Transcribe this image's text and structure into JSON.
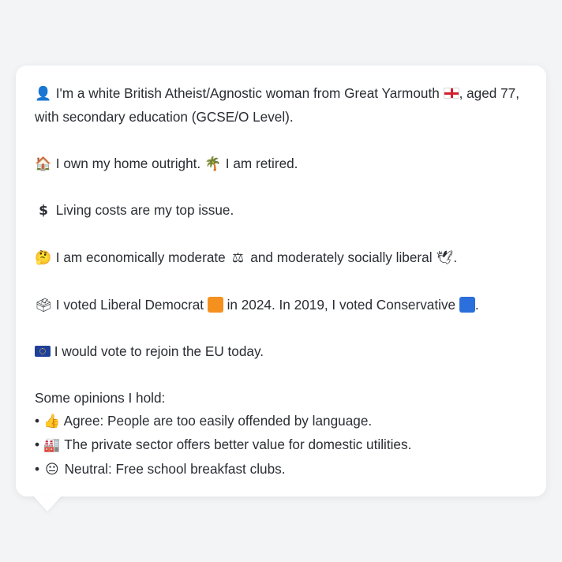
{
  "profile": {
    "intro_icon": "bust-in-silhouette-icon",
    "intro_text_1": "I'm a white British Atheist/Agnostic woman from Great Yarmouth",
    "intro_flag": "england-flag-icon",
    "intro_text_2": ", aged 77, with secondary education (GCSE/O Level).",
    "home_icon": "house-icon",
    "home_text": "I own my home outright.",
    "retired_icon": "palm-tree-icon",
    "retired_text": "I am retired.",
    "cost_icon": "dollar-sign-icon",
    "cost_text": "Living costs are my top issue.",
    "thinking_icon": "thinking-face-icon",
    "econ_text": "I am economically moderate",
    "scales_icon": "balance-scale-icon",
    "social_text": "and moderately socially liberal",
    "dove_icon": "dove-icon",
    "vote_icon": "ballot-box-icon",
    "vote_text_1": "I voted Liberal Democrat",
    "vote_colour_2024": "#f4901e",
    "vote_text_2": "in 2024. In 2019, I voted Conservative",
    "vote_colour_2019": "#2a6fdb",
    "eu_icon": "eu-flag-icon",
    "eu_text": "I would vote to rejoin the EU today.",
    "opinions_heading": "Some opinions I hold:",
    "opinions": [
      {
        "bullet": "•",
        "icon": "thumbs-up-icon",
        "text": "Agree: People are too easily offended by language."
      },
      {
        "bullet": "•",
        "icon": "factory-icon",
        "text": "The private sector offers better value for domestic utilities."
      },
      {
        "bullet": "•",
        "icon": "neutral-face-icon",
        "text": "Neutral: Free school breakfast clubs."
      }
    ]
  }
}
